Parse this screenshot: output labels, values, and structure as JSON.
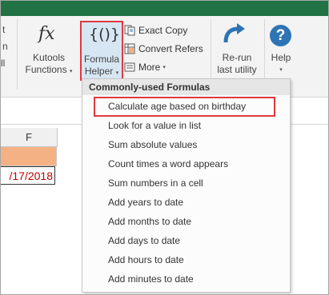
{
  "ribbon": {
    "kutools_functions": {
      "line1": "Kutools",
      "line2": "Functions",
      "glyph": "fx",
      "arrow": "▾"
    },
    "formula_helper": {
      "line1": "Formula",
      "line2": "Helper",
      "glyph": "{()}",
      "arrow": "▾"
    },
    "exact_copy": {
      "label": "Exact Copy"
    },
    "convert_refers": {
      "label": "Convert Refers"
    },
    "more": {
      "label": "More",
      "arrow": "▾"
    },
    "rerun": {
      "line1": "Re-run",
      "line2": "last utility"
    },
    "help": {
      "label": "Help",
      "glyph": "?",
      "arrow": "▾"
    },
    "left_fragments": [
      "t",
      "n",
      "ll"
    ]
  },
  "sheet": {
    "column_header": "F",
    "date_value": "/17/2018"
  },
  "menu": {
    "header": "Commonly-used Formulas",
    "items": [
      "Calculate age based on birthday",
      "Look for a value in list",
      "Sum absolute values",
      "Count times a word appears",
      "Sum numbers in a cell",
      "Add years to date",
      "Add months to date",
      "Add days to date",
      "Add hours to date",
      "Add minutes to date"
    ]
  },
  "colors": {
    "accent_red": "#e0393e",
    "excel_green": "#217346",
    "help_blue": "#2e74b5",
    "header_orange": "#f4b183",
    "date_red": "#c00000"
  }
}
